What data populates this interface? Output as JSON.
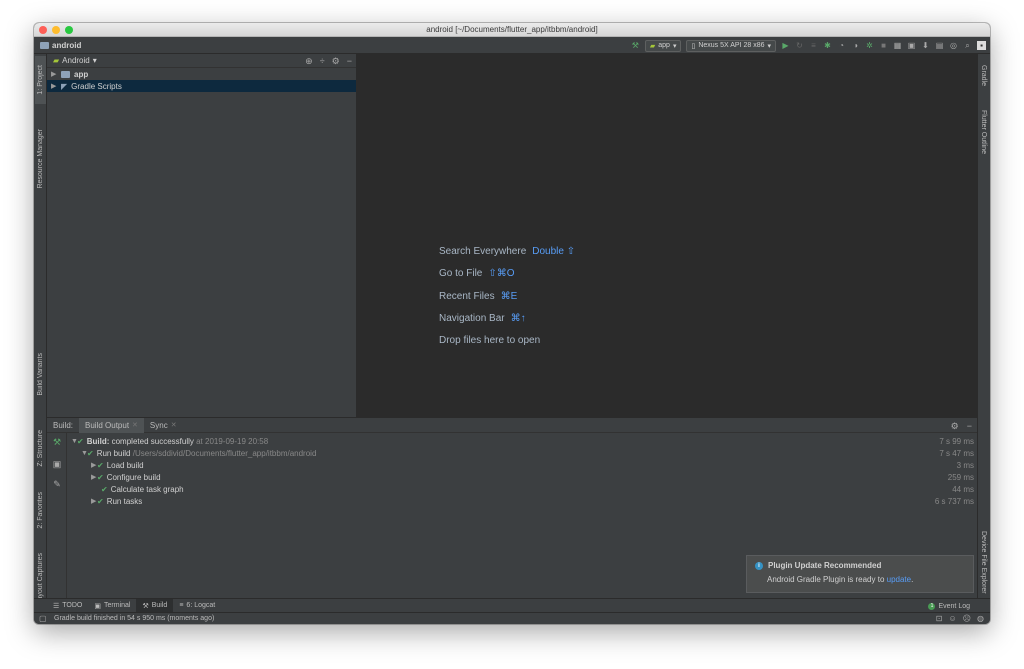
{
  "window": {
    "title": "android [~/Documents/flutter_app/itbbm/android]"
  },
  "navbar": {
    "project": "android"
  },
  "toolbar": {
    "run_config": "app",
    "device": "Nexus 5X API 28 x86"
  },
  "left_stripe": {
    "project_tab": "1: Project",
    "resource_manager_tab": "Resource Manager",
    "build_variants_tab": "Build Variants",
    "structure_tab": "Z: Structure",
    "favorites_tab": "2: Favorites",
    "layout_captures_tab": "Layout Captures"
  },
  "right_stripe": {
    "gradle_tab": "Gradle",
    "flutter_outline_tab": "Flutter Outline",
    "device_file_explorer_tab": "Device File Explorer"
  },
  "project_panel": {
    "view_mode": "Android",
    "items": [
      {
        "label": "app",
        "bold": true
      },
      {
        "label": "Gradle Scripts",
        "bold": false
      }
    ]
  },
  "editor": {
    "hints": [
      {
        "label": "Search Everywhere",
        "shortcut": "Double ⇧"
      },
      {
        "label": "Go to File",
        "shortcut": "⇧⌘O"
      },
      {
        "label": "Recent Files",
        "shortcut": "⌘E"
      },
      {
        "label": "Navigation Bar",
        "shortcut": "⌘↑"
      },
      {
        "label": "Drop files here to open",
        "shortcut": ""
      }
    ]
  },
  "build_panel": {
    "label": "Build:",
    "tabs": [
      "Build Output",
      "Sync"
    ],
    "rows": [
      {
        "text": "Build:",
        "detail": "completed successfully",
        "extra": "at 2019-09-19 20:58",
        "duration": "7 s 99 ms"
      },
      {
        "text": "Run build",
        "detail": "",
        "extra": "/Users/sddivid/Documents/flutter_app/itbbm/android",
        "duration": "7 s 47 ms"
      },
      {
        "text": "Load build",
        "detail": "",
        "extra": "",
        "duration": "3 ms"
      },
      {
        "text": "Configure build",
        "detail": "",
        "extra": "",
        "duration": "259 ms"
      },
      {
        "text": "Calculate task graph",
        "detail": "",
        "extra": "",
        "duration": "44 ms"
      },
      {
        "text": "Run tasks",
        "detail": "",
        "extra": "",
        "duration": "6 s 737 ms"
      }
    ]
  },
  "notification": {
    "title": "Plugin Update Recommended",
    "message": "Android Gradle Plugin is ready to ",
    "link": "update",
    "period": "."
  },
  "tool_windows": {
    "todo": "TODO",
    "terminal": "Terminal",
    "build": "Build",
    "logcat": "6: Logcat",
    "event_log": "Event Log",
    "event_count": "1"
  },
  "status": {
    "text": "Gradle build finished in 54 s 950 ms (moments ago)"
  },
  "colors": {
    "accent": "#589df6",
    "success": "#59a869",
    "editor_bg": "#2b2b2b",
    "panel_bg": "#3c3f41"
  }
}
